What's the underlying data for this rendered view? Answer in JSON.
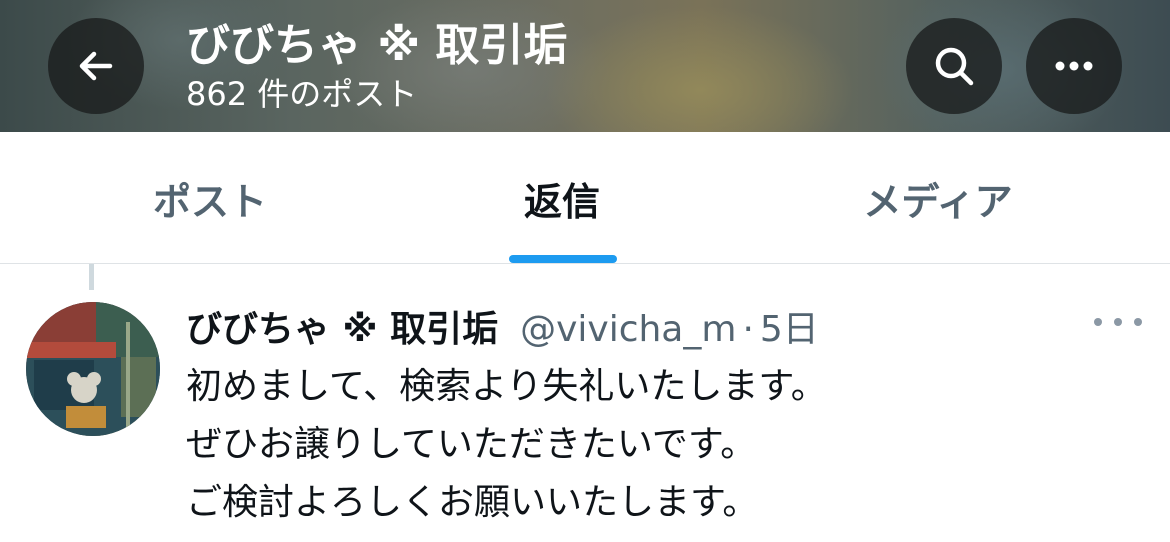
{
  "header": {
    "title": "びびちゃ ※ 取引垢",
    "post_count": "862 件のポスト",
    "back_icon": "arrow-left-icon",
    "search_icon": "search-icon",
    "more_icon": "more-horizontal-icon"
  },
  "tabs": [
    {
      "label": "ポスト",
      "active": false
    },
    {
      "label": "返信",
      "active": true
    },
    {
      "label": "メディア",
      "active": false
    }
  ],
  "colors": {
    "accent": "#1d9bf0",
    "text_primary": "#0f1419",
    "text_secondary": "#536471"
  },
  "tweet": {
    "display_name": "びびちゃ ※ 取引垢",
    "handle": "@vivicha_m",
    "separator": "·",
    "time": "5日",
    "more_icon": "more-horizontal-icon",
    "lines": [
      "初めまして、検索より失礼いたします。",
      "ぜひお譲りしていただきたいです。",
      "ご検討よろしくお願いいたします。"
    ]
  }
}
